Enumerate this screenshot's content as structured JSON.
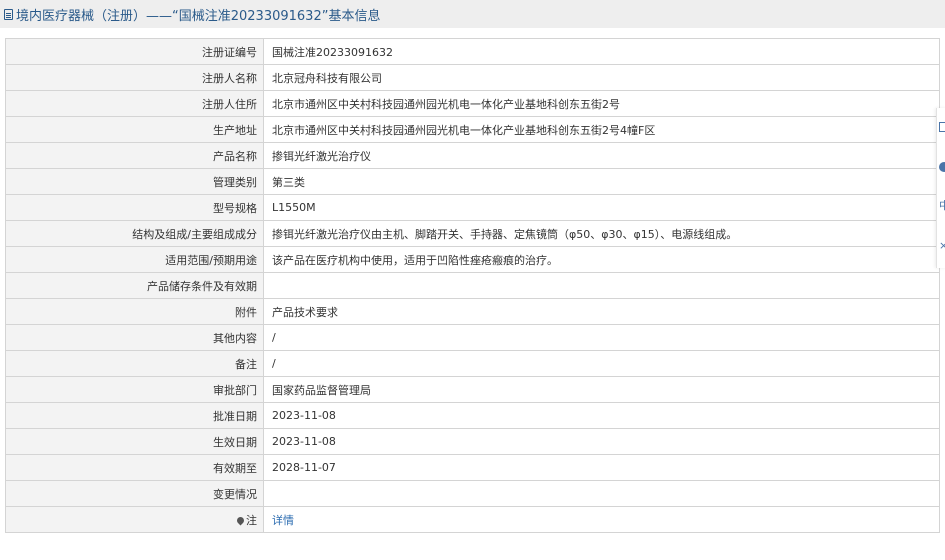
{
  "header": {
    "title": "境内医疗器械（注册）——“国械注准20233091632”基本信息"
  },
  "rows": [
    {
      "label": "注册证编号",
      "value": "国械注准20233091632"
    },
    {
      "label": "注册人名称",
      "value": "北京冠舟科技有限公司"
    },
    {
      "label": "注册人住所",
      "value": "北京市通州区中关村科技园通州园光机电一体化产业基地科创东五街2号"
    },
    {
      "label": "生产地址",
      "value": "北京市通州区中关村科技园通州园光机电一体化产业基地科创东五街2号4幢F区"
    },
    {
      "label": "产品名称",
      "value": "掺铒光纤激光治疗仪"
    },
    {
      "label": "管理类别",
      "value": "第三类"
    },
    {
      "label": "型号规格",
      "value": "L1550M"
    },
    {
      "label": "结构及组成/主要组成成分",
      "value": "掺铒光纤激光治疗仪由主机、脚踏开关、手持器、定焦镜筒（φ50、φ30、φ15）、电源线组成。"
    },
    {
      "label": "适用范围/预期用途",
      "value": "该产品在医疗机构中使用，适用于凹陷性痤疮瘢痕的治疗。"
    },
    {
      "label": "产品储存条件及有效期",
      "value": ""
    },
    {
      "label": "附件",
      "value": "产品技术要求"
    },
    {
      "label": "其他内容",
      "value": "/"
    },
    {
      "label": "备注",
      "value": "/"
    },
    {
      "label": "审批部门",
      "value": "国家药品监督管理局"
    },
    {
      "label": "批准日期",
      "value": "2023-11-08"
    },
    {
      "label": "生效日期",
      "value": "2023-11-08"
    },
    {
      "label": "有效期至",
      "value": "2028-11-07"
    },
    {
      "label": "变更情况",
      "value": ""
    }
  ],
  "note_row": {
    "label": "注",
    "link": "详情"
  },
  "side_toolbar": {
    "glyph_1": "中",
    "glyph_2": "×"
  }
}
